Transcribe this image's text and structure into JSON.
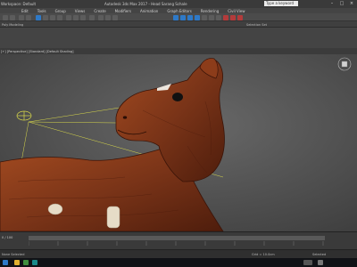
{
  "titlebar": {
    "workspace": "Workspace: Default",
    "title": "Autodesk 3ds Max 2017 - Head Sarang Schale",
    "search_placeholder": "Type a keyword or phrase"
  },
  "menubar": {
    "items": [
      "Edit",
      "Tools",
      "Group",
      "Views",
      "Create",
      "Modifiers",
      "Animation",
      "Graph Editors",
      "Rendering",
      "Civil View"
    ]
  },
  "toolbar2": {
    "left_label": "Poly Modeling",
    "center_label": "Selection Set"
  },
  "viewport": {
    "label": "[+] [Perspective] [Standard] [Default Shading]"
  },
  "timeline": {
    "frame": "0 / 100"
  },
  "statusbar": {
    "left": "None Selected",
    "right": "Selected",
    "grid": "Grid = 10.0cm"
  },
  "colors": {
    "wood": "#7a3418",
    "wood_dark": "#4a1a0c",
    "accent": "#2e79c7"
  }
}
